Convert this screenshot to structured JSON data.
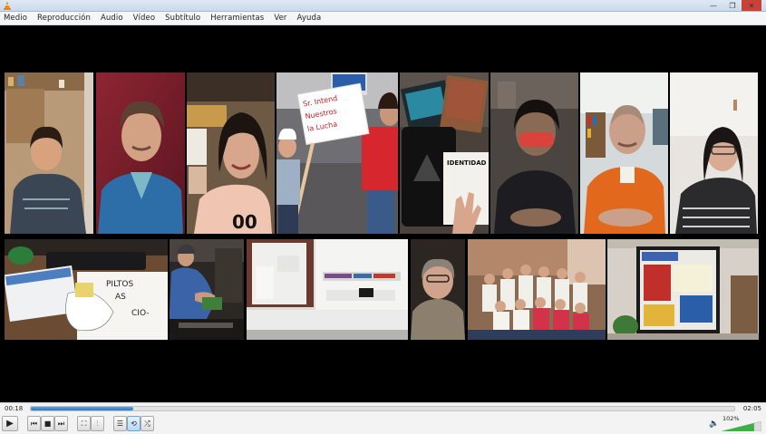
{
  "window": {
    "minimize_glyph": "—",
    "maximize_glyph": "❐",
    "close_glyph": "✕"
  },
  "menu": {
    "items": [
      "Medio",
      "Reproducción",
      "Audio",
      "Vídeo",
      "Subtítulo",
      "Herramientas",
      "Ver",
      "Ayuda"
    ]
  },
  "video": {
    "sign_text": [
      "Sr. Intend",
      "Nuestros",
      "la Lucha"
    ],
    "book_label": "IDENTIDAD",
    "paper_text": [
      "PILTOS",
      "AS",
      "CIO-"
    ],
    "jersey_text": "00"
  },
  "controls": {
    "time_elapsed": "00:18",
    "time_total": "02:05",
    "progress": 0.146,
    "volume_label": "102%",
    "volume": 1.02,
    "icons": {
      "play": "▶",
      "prev": "⏮",
      "stop": "■",
      "next": "⏭",
      "fullscreen": "⛶",
      "extended": "⫶",
      "playlist": "☰",
      "loop": "⟲",
      "random": "⤮",
      "volume": "🔈"
    }
  },
  "colors": {
    "accent": "#2b78c6",
    "volume": "#3cb043",
    "close": "#c8423a"
  }
}
